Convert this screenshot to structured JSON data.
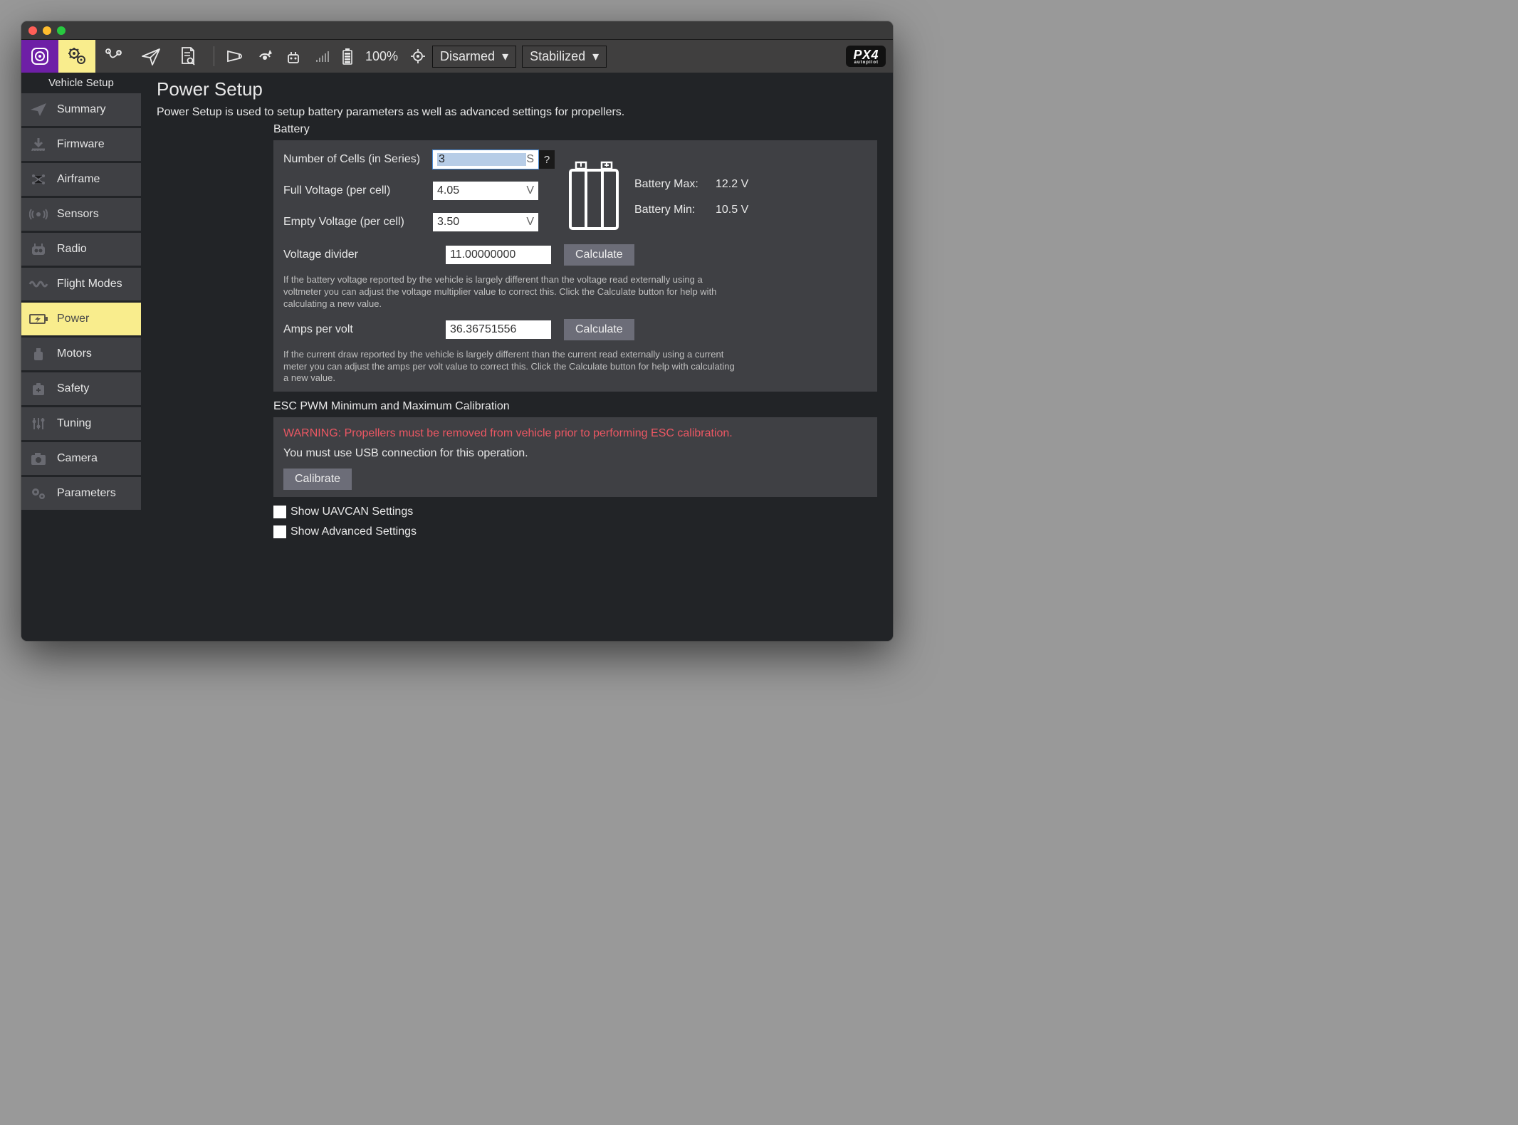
{
  "toolbar": {
    "battery_pct": "100%",
    "armed_dd": "Disarmed",
    "mode_dd": "Stabilized",
    "logo": "PX4"
  },
  "sidebar": {
    "title": "Vehicle Setup",
    "items": [
      {
        "label": "Summary"
      },
      {
        "label": "Firmware"
      },
      {
        "label": "Airframe"
      },
      {
        "label": "Sensors"
      },
      {
        "label": "Radio"
      },
      {
        "label": "Flight Modes"
      },
      {
        "label": "Power"
      },
      {
        "label": "Motors"
      },
      {
        "label": "Safety"
      },
      {
        "label": "Tuning"
      },
      {
        "label": "Camera"
      },
      {
        "label": "Parameters"
      }
    ]
  },
  "main": {
    "title": "Power Setup",
    "description": "Power Setup is used to setup battery parameters as well as advanced settings for propellers.",
    "battery": {
      "section_title": "Battery",
      "cells_label": "Number of Cells (in Series)",
      "cells_value": "3",
      "cells_unit": "S",
      "full_label": "Full Voltage (per cell)",
      "full_value": "4.05",
      "full_unit": "V",
      "empty_label": "Empty Voltage (per cell)",
      "empty_value": "3.50",
      "empty_unit": "V",
      "vdiv_label": "Voltage divider",
      "vdiv_value": "11.00000000",
      "vdiv_help": "If the battery voltage reported by the vehicle is largely different than the voltage read externally using a voltmeter you can adjust the voltage multiplier value to correct this. Click the Calculate button for help with calculating a new value.",
      "apv_label": "Amps per volt",
      "apv_value": "36.36751556",
      "apv_help": "If the current draw reported by the vehicle is largely different than the current read externally using a current meter you can adjust the amps per volt value to correct this. Click the Calculate button for help with calculating a new value.",
      "calculate_btn": "Calculate",
      "help_btn": "?",
      "max_label": "Battery Max:",
      "max_val": "12.2 V",
      "min_label": "Battery Min:",
      "min_val": "10.5 V"
    },
    "esc": {
      "section_title": "ESC PWM Minimum and Maximum Calibration",
      "warning": "WARNING: Propellers must be removed from vehicle prior to performing ESC calibration.",
      "usb_note": "You must use USB connection for this operation.",
      "calibrate_btn": "Calibrate"
    },
    "uavcan_label": "Show UAVCAN Settings",
    "advanced_label": "Show Advanced Settings"
  }
}
